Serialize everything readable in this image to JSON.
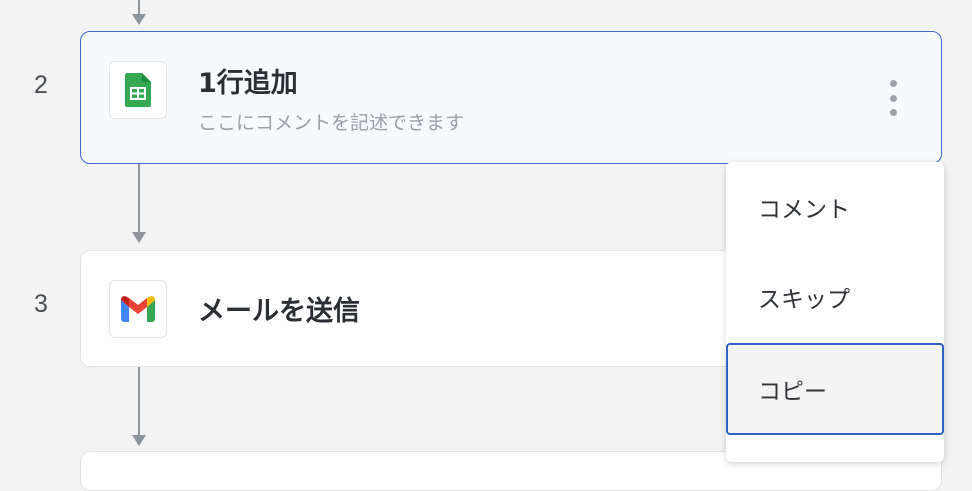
{
  "steps": [
    {
      "number": "2",
      "title": "1行追加",
      "comment": "ここにコメントを記述できます",
      "app": "google-sheets",
      "selected": true
    },
    {
      "number": "3",
      "title": "メールを送信",
      "comment": "",
      "app": "gmail",
      "selected": false
    }
  ],
  "menu": {
    "items": [
      {
        "label": "コメント"
      },
      {
        "label": "スキップ"
      },
      {
        "label": "コピー"
      }
    ],
    "active_index": 2
  },
  "icons": {
    "sheets": "google-sheets-icon",
    "gmail": "gmail-icon",
    "more": "more-vertical-icon"
  },
  "colors": {
    "accent": "#3d68c4",
    "connector": "#8e949b",
    "sheets_green": "#34a853",
    "background": "#f3f3f3"
  }
}
